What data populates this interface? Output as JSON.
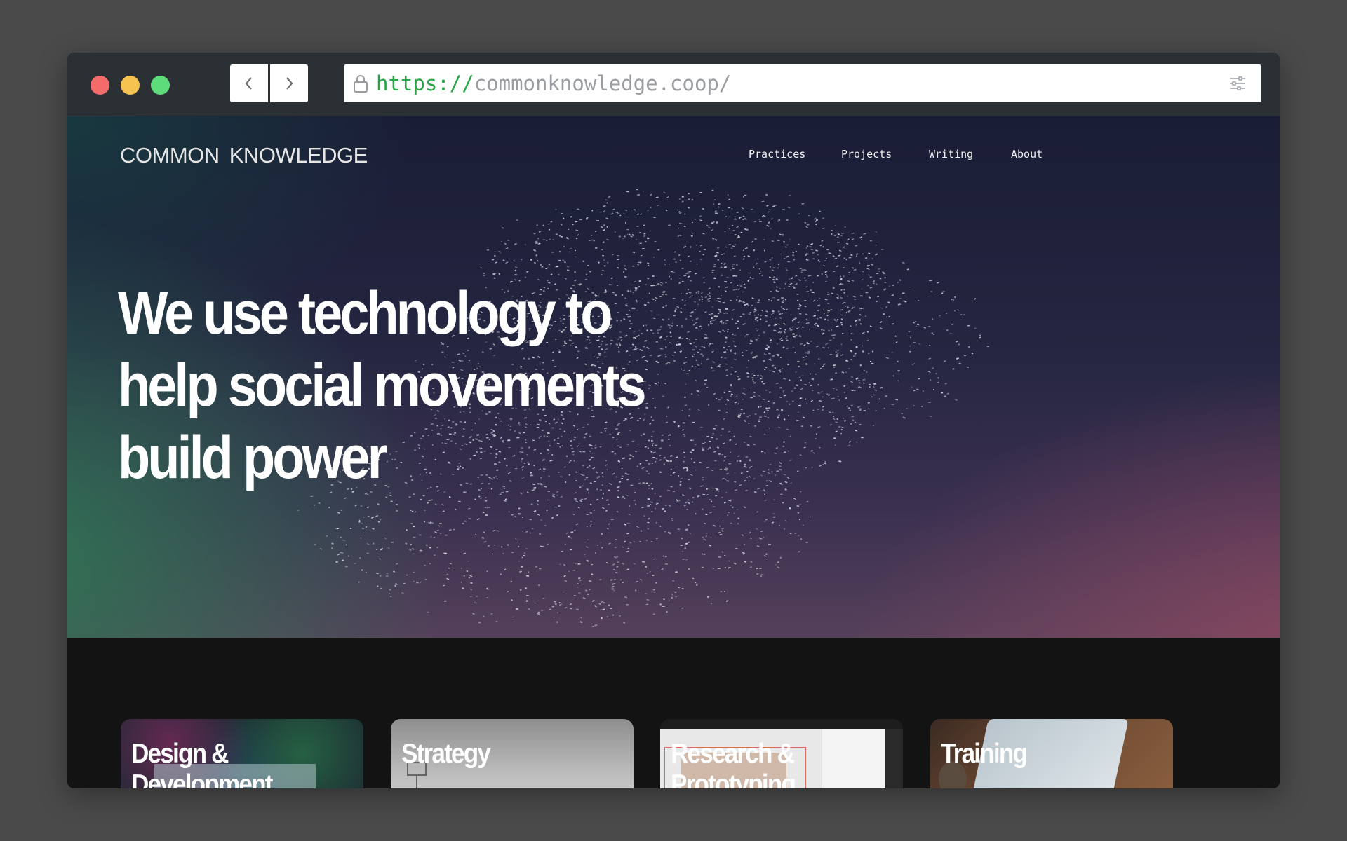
{
  "browser": {
    "url_scheme": "https://",
    "url_host": "commonknowledge.coop/"
  },
  "site": {
    "brand": "COMMON KNOWLEDGE",
    "nav": [
      {
        "label": "Practices"
      },
      {
        "label": "Projects"
      },
      {
        "label": "Writing"
      },
      {
        "label": "About"
      }
    ],
    "headline_lines": [
      "We use technology to",
      "help social movements",
      "build power"
    ]
  },
  "services": [
    {
      "title": "Design & Development"
    },
    {
      "title": "Strategy"
    },
    {
      "title": "Research & Prototyping"
    },
    {
      "title": "Training"
    }
  ],
  "colors": {
    "window_chrome": "#2b3035",
    "light_red": "#f56b6b",
    "light_yellow": "#f6c350",
    "light_green": "#5fdc7a",
    "url_scheme": "#27a544",
    "url_host": "#9a9ea3",
    "page_dark": "#131313"
  }
}
